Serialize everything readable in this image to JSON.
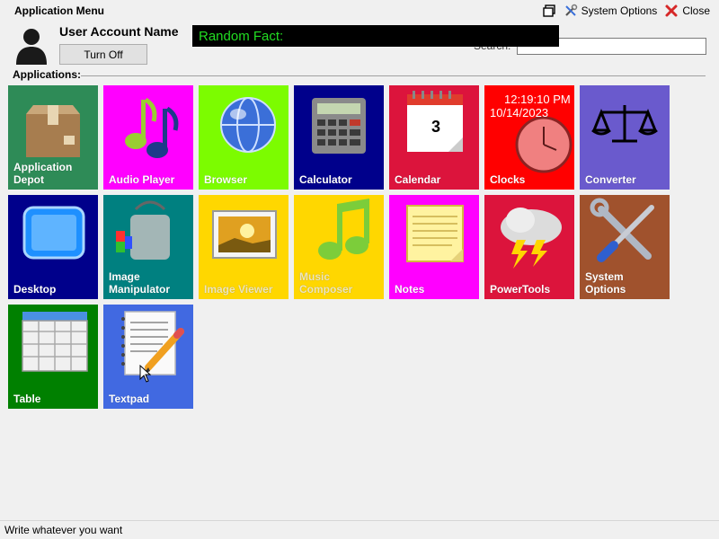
{
  "window": {
    "title": "Application Menu",
    "system_options_label": "System Options",
    "close_label": "Close"
  },
  "user": {
    "account_name": "User Account Name",
    "turn_off_label": "Turn Off"
  },
  "fact": {
    "label": "Random Fact:"
  },
  "search": {
    "label": "Search:",
    "value": "",
    "placeholder": ""
  },
  "apps_label": "Applications:",
  "tiles": [
    {
      "label": "Application Depot",
      "color": "#2e8b57",
      "icon": "package-icon"
    },
    {
      "label": "Audio Player",
      "color": "#ff00ff",
      "icon": "music-notes-icon"
    },
    {
      "label": "Browser",
      "color": "#7cfc00",
      "icon": "globe-icon"
    },
    {
      "label": "Calculator",
      "color": "#00008b",
      "icon": "calculator-icon"
    },
    {
      "label": "Calendar",
      "color": "#dc143c",
      "icon": "calendar-icon"
    },
    {
      "label": "Clocks",
      "color": "#ff0000",
      "icon": "clock-icon"
    },
    {
      "label": "Converter",
      "color": "#6a5acd",
      "icon": "scales-icon"
    },
    {
      "label": "Desktop",
      "color": "#00008b",
      "icon": "monitor-icon"
    },
    {
      "label": "Image Manipulator",
      "color": "#008080",
      "icon": "paint-bucket-icon"
    },
    {
      "label": "Image Viewer",
      "color": "#ffd700",
      "icon": "picture-icon"
    },
    {
      "label": "Music Composer",
      "color": "#ffd700",
      "icon": "music-note-icon"
    },
    {
      "label": "Notes",
      "color": "#ff00ff",
      "icon": "notepad-icon"
    },
    {
      "label": "PowerTools",
      "color": "#dc143c",
      "icon": "storm-cloud-icon"
    },
    {
      "label": "System Options",
      "color": "#a0522d",
      "icon": "tools-icon"
    },
    {
      "label": "Table",
      "color": "#008000",
      "icon": "table-icon"
    },
    {
      "label": "Textpad",
      "color": "#4169e1",
      "icon": "notebook-pencil-icon"
    }
  ],
  "calendar_day": "3",
  "clock": {
    "time": "12:19:10 PM",
    "date": "10/14/2023"
  },
  "status_text": "Write whatever you want"
}
